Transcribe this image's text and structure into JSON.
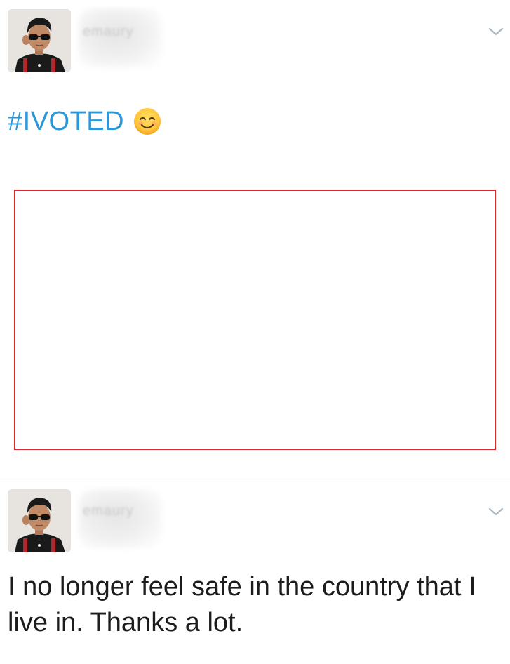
{
  "tweets": [
    {
      "display_name": "emaury",
      "hashtag": "#IVOTED",
      "emoji": "smiling-face-with-smiling-eyes",
      "media_placeholder_border_color": "#e0262b"
    },
    {
      "display_name": "emaury",
      "text": "I no longer feel safe in the country that I live in. Thanks a lot."
    }
  ],
  "colors": {
    "hashtag": "#2a97d8",
    "text": "#1c1c1c",
    "chevron": "#aab8c2"
  },
  "icons": {
    "options": "chevron-down-icon",
    "avatar": "avatar"
  }
}
